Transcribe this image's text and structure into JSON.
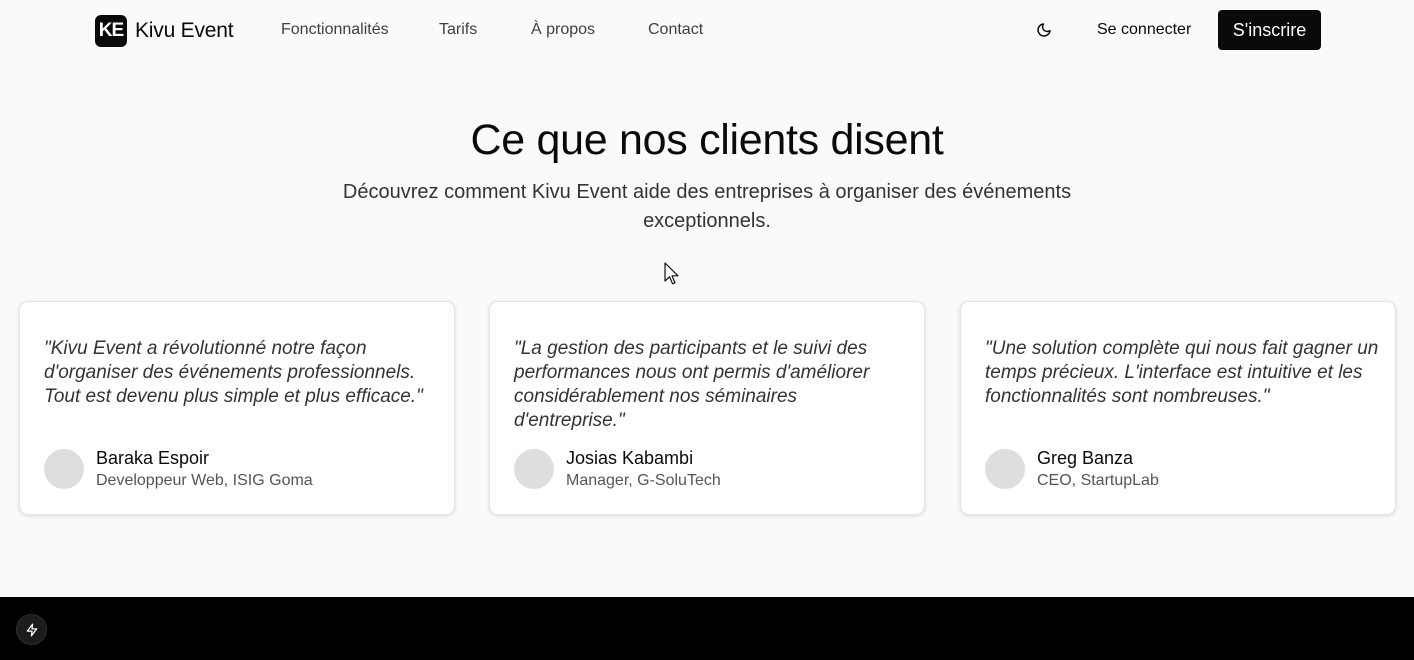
{
  "brand": {
    "logo_initials": "KE",
    "name": "Kivu Event"
  },
  "nav": {
    "items": [
      {
        "label": "Fonctionnalités"
      },
      {
        "label": "Tarifs"
      },
      {
        "label": "À propos"
      },
      {
        "label": "Contact"
      }
    ]
  },
  "header_actions": {
    "theme_toggle_icon": "moon-icon",
    "login_label": "Se connecter",
    "signup_label": "S'inscrire"
  },
  "testimonials": {
    "title": "Ce que nos clients disent",
    "subtitle": "Découvrez comment Kivu Event aide des entreprises à organiser des événements exceptionnels.",
    "cards": [
      {
        "quote": "\"Kivu Event a révolutionné notre façon d'organiser des événements professionnels. Tout est devenu plus simple et plus efficace.\"",
        "name": "Baraka Espoir",
        "role": "Developpeur Web, ISIG Goma"
      },
      {
        "quote": "\"La gestion des participants et le suivi des performances nous ont permis d'améliorer considérablement nos séminaires d'entreprise.\"",
        "name": "Josias Kabambi",
        "role": "Manager, G-SoluTech"
      },
      {
        "quote": "\"Une solution complète qui nous fait gagner un temps précieux. L'interface est intuitive et les fonctionnalités sont nombreuses.\"",
        "name": "Greg Banza",
        "role": "CEO, StartupLab"
      }
    ]
  },
  "footer": {
    "fab_icon": "lightning-icon"
  },
  "colors": {
    "background": "#fafafa",
    "primary": "#0a0a0a",
    "footer": "#000000",
    "card": "#ffffff"
  }
}
